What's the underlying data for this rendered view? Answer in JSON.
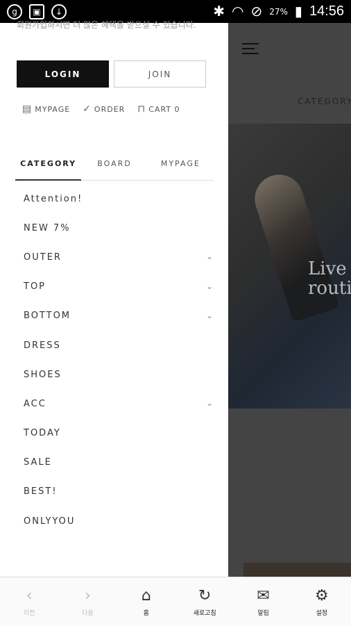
{
  "status_bar": {
    "time": "14:56",
    "battery": "27%",
    "icons": [
      "g-app-icon",
      "image-icon",
      "download-icon",
      "bluetooth-icon",
      "wifi-icon",
      "do-not-disturb-icon",
      "battery-icon"
    ]
  },
  "drawer": {
    "note": "회원가입하시면 더 많은 혜택을 받으실 수 있습니다.",
    "login_label": "LOGIN",
    "join_label": "JOIN",
    "quick_links": {
      "mypage": "MYPAGE",
      "order": "ORDER",
      "cart": "CART 0"
    },
    "tabs": [
      {
        "label": "CATEGORY",
        "active": true
      },
      {
        "label": "BOARD",
        "active": false
      },
      {
        "label": "MYPAGE",
        "active": false
      }
    ],
    "menu": [
      {
        "label": "Attention!",
        "expandable": false
      },
      {
        "label": "NEW 7%",
        "expandable": false
      },
      {
        "label": "OUTER",
        "expandable": true
      },
      {
        "label": "TOP",
        "expandable": true
      },
      {
        "label": "BOTTOM",
        "expandable": true
      },
      {
        "label": "DRESS",
        "expandable": false
      },
      {
        "label": "SHOES",
        "expandable": false
      },
      {
        "label": "ACC",
        "expandable": true
      },
      {
        "label": "TODAY",
        "expandable": false
      },
      {
        "label": "SALE",
        "expandable": false
      },
      {
        "label": "BEST!",
        "expandable": false
      },
      {
        "label": "ONLYYOU",
        "expandable": false
      }
    ]
  },
  "background_page": {
    "category_label": "CATEGORY",
    "hero_text_line1": "Live",
    "hero_text_line2": "routi"
  },
  "bottom_nav": [
    {
      "label": "이전",
      "icon": "chevron-left-icon",
      "disabled": true
    },
    {
      "label": "다음",
      "icon": "chevron-right-icon",
      "disabled": true
    },
    {
      "label": "홈",
      "icon": "home-icon",
      "disabled": false
    },
    {
      "label": "새로고침",
      "icon": "refresh-icon",
      "disabled": false
    },
    {
      "label": "알림",
      "icon": "mail-icon",
      "disabled": false
    },
    {
      "label": "설정",
      "icon": "gear-icon",
      "disabled": false
    }
  ]
}
